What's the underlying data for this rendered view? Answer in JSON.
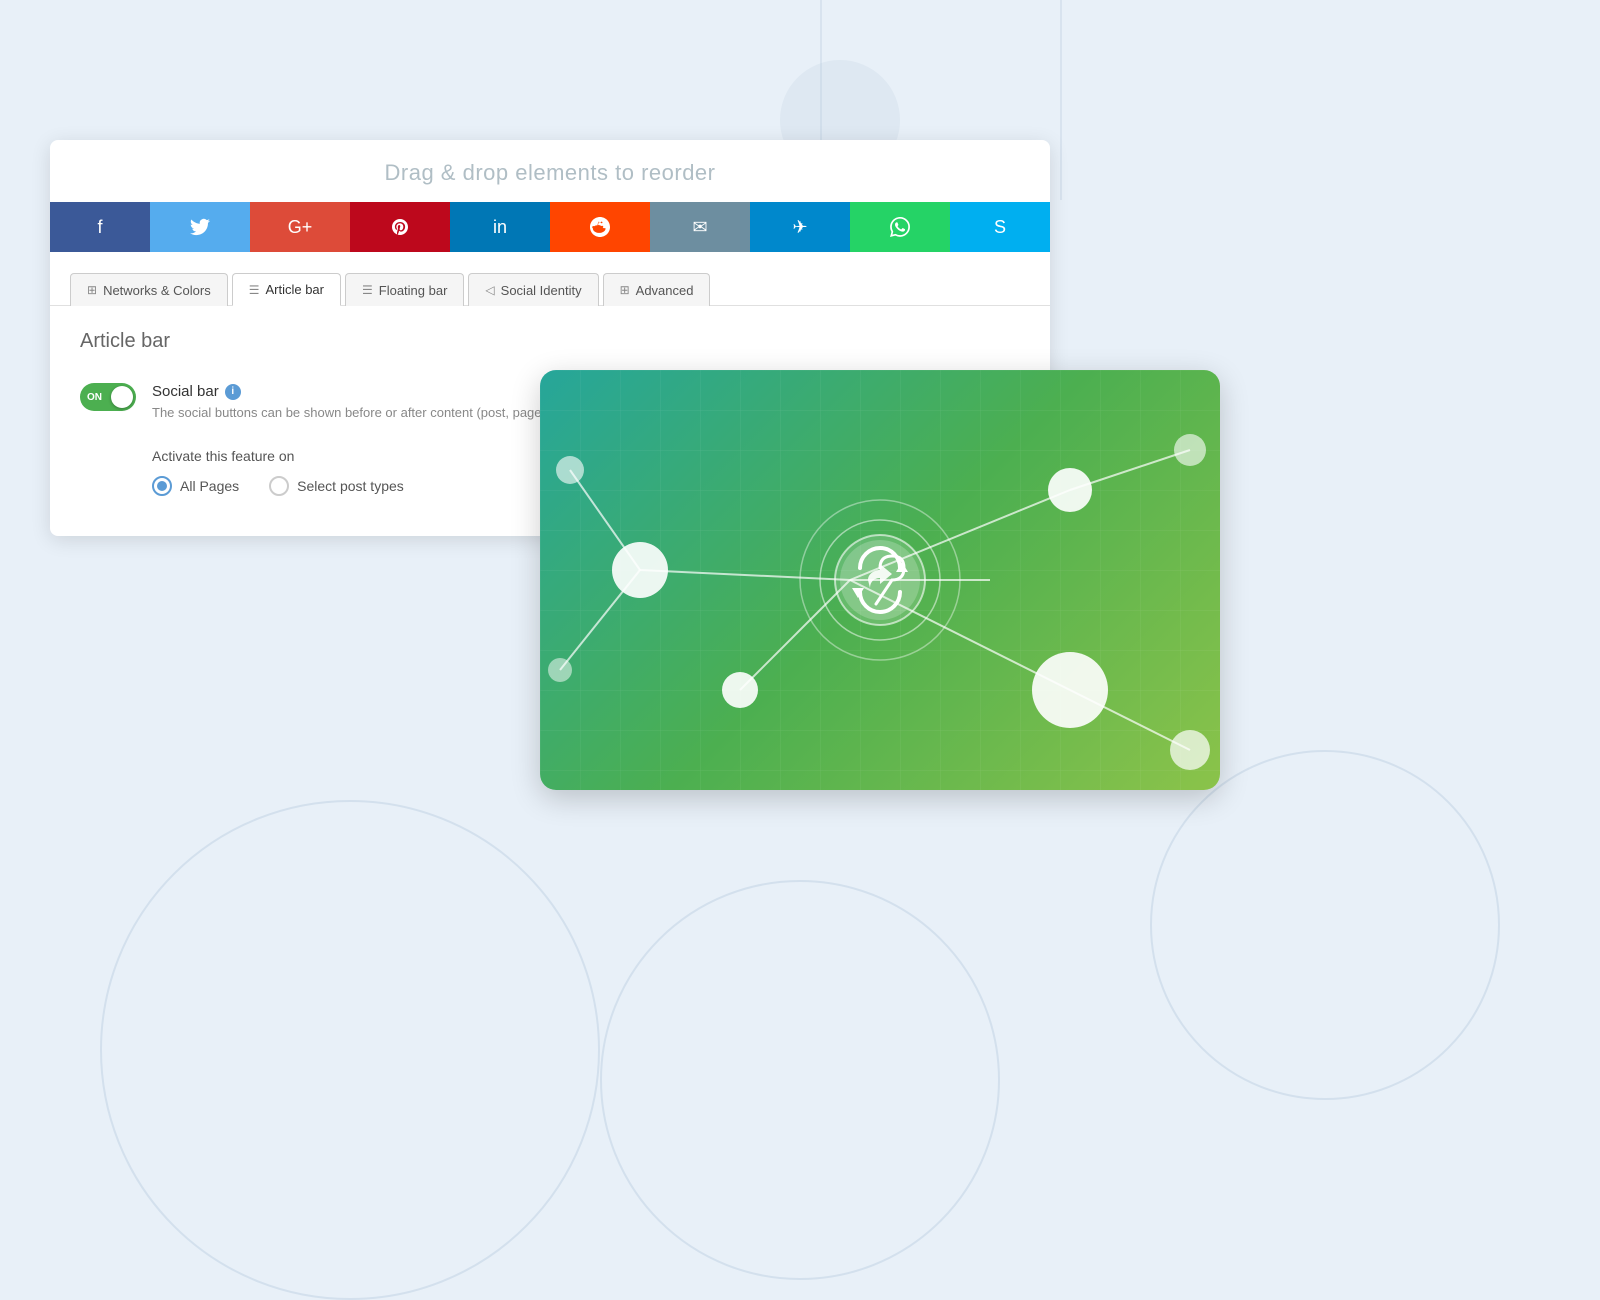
{
  "page": {
    "drag_header": "Drag & drop elements to reorder",
    "background_color": "#e8f0f8"
  },
  "social_buttons": [
    {
      "id": "facebook",
      "icon": "f",
      "color": "#3b5998"
    },
    {
      "id": "twitter",
      "icon": "𝕋",
      "color": "#55acee"
    },
    {
      "id": "google-plus",
      "icon": "G+",
      "color": "#dd4b39"
    },
    {
      "id": "pinterest",
      "icon": "𝒫",
      "color": "#bd081c"
    },
    {
      "id": "linkedin",
      "icon": "in",
      "color": "#0077b5"
    },
    {
      "id": "reddit",
      "icon": "●",
      "color": "#ff4500"
    },
    {
      "id": "email",
      "icon": "✉",
      "color": "#6d8ea0"
    },
    {
      "id": "telegram",
      "icon": "✈",
      "color": "#0088cc"
    },
    {
      "id": "whatsapp",
      "icon": "✆",
      "color": "#25d366"
    },
    {
      "id": "skype",
      "icon": "S",
      "color": "#00aff0"
    }
  ],
  "tabs": [
    {
      "id": "networks-colors",
      "label": "Networks & Colors",
      "icon": "⊞",
      "active": false
    },
    {
      "id": "article-bar",
      "label": "Article bar",
      "icon": "☰",
      "active": true
    },
    {
      "id": "floating-bar",
      "label": "Floating bar",
      "icon": "☰",
      "active": false
    },
    {
      "id": "social-identity",
      "label": "Social Identity",
      "icon": "◁",
      "active": false
    },
    {
      "id": "advanced",
      "label": "Advanced",
      "icon": "⊞",
      "active": false
    }
  ],
  "content": {
    "section_title": "Article bar",
    "social_bar": {
      "title": "Social bar",
      "description": "The social buttons can be shown before or after content (post, page, custo...",
      "toggle_state": "ON",
      "toggle_on": true
    },
    "activate": {
      "label": "Activate this feature on",
      "options": [
        {
          "id": "all-pages",
          "label": "All Pages",
          "selected": true
        },
        {
          "id": "select-post-types",
          "label": "Select post types",
          "selected": false
        }
      ]
    }
  }
}
